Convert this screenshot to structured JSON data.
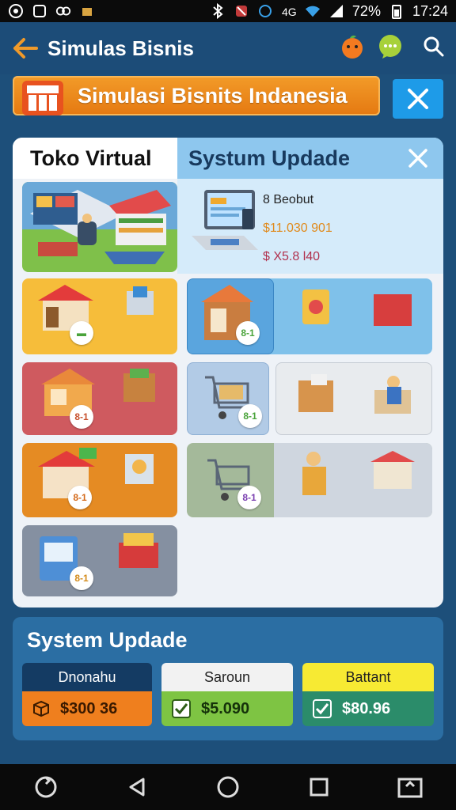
{
  "status_bar": {
    "time": "17:24",
    "battery": "72%"
  },
  "app_bar": {
    "title": "Simulas Bisnis"
  },
  "banner": {
    "text": "Simulasi Bisnits Indanesia"
  },
  "panel": {
    "tab_left": "Toko Virtual",
    "tab_right": "Systum Updade",
    "info": {
      "line1": "8 Beobut",
      "line2": "$11.030 901",
      "line3": "$ X5.8 l40"
    }
  },
  "tiles": [
    {
      "label": "",
      "badge": "",
      "color": "#7fc04a"
    },
    {
      "label": "",
      "badge": "▬",
      "color": "#f6bd3a"
    },
    {
      "label": "",
      "badge": "8-1",
      "color": "#cf5a5f"
    },
    {
      "label": "",
      "badge": "8-1",
      "color": "#e58b23"
    },
    {
      "label": "",
      "badge": "8-1",
      "color": "#8590a1"
    },
    {
      "label": "",
      "badge": "8-1",
      "color": "#7fc1ea"
    },
    {
      "label": "",
      "badge": "8-1",
      "color": "#b2cbe6"
    },
    {
      "label": "",
      "badge": "8-1",
      "color": "#a4b99a"
    }
  ],
  "system_update": {
    "title": "System Updade",
    "cards": [
      {
        "header": "Dnonahu",
        "value": "$300 36",
        "header_bg": "#143b63",
        "body_bg": "#ef7f1e"
      },
      {
        "header": "Saroun",
        "value": "$5.090",
        "header_bg": "#f2f2f2",
        "body_bg": "#7ec443"
      },
      {
        "header": "Battant",
        "value": "$80.96",
        "header_bg": "#f7ea33",
        "body_bg": "#2b8c6a"
      }
    ]
  }
}
